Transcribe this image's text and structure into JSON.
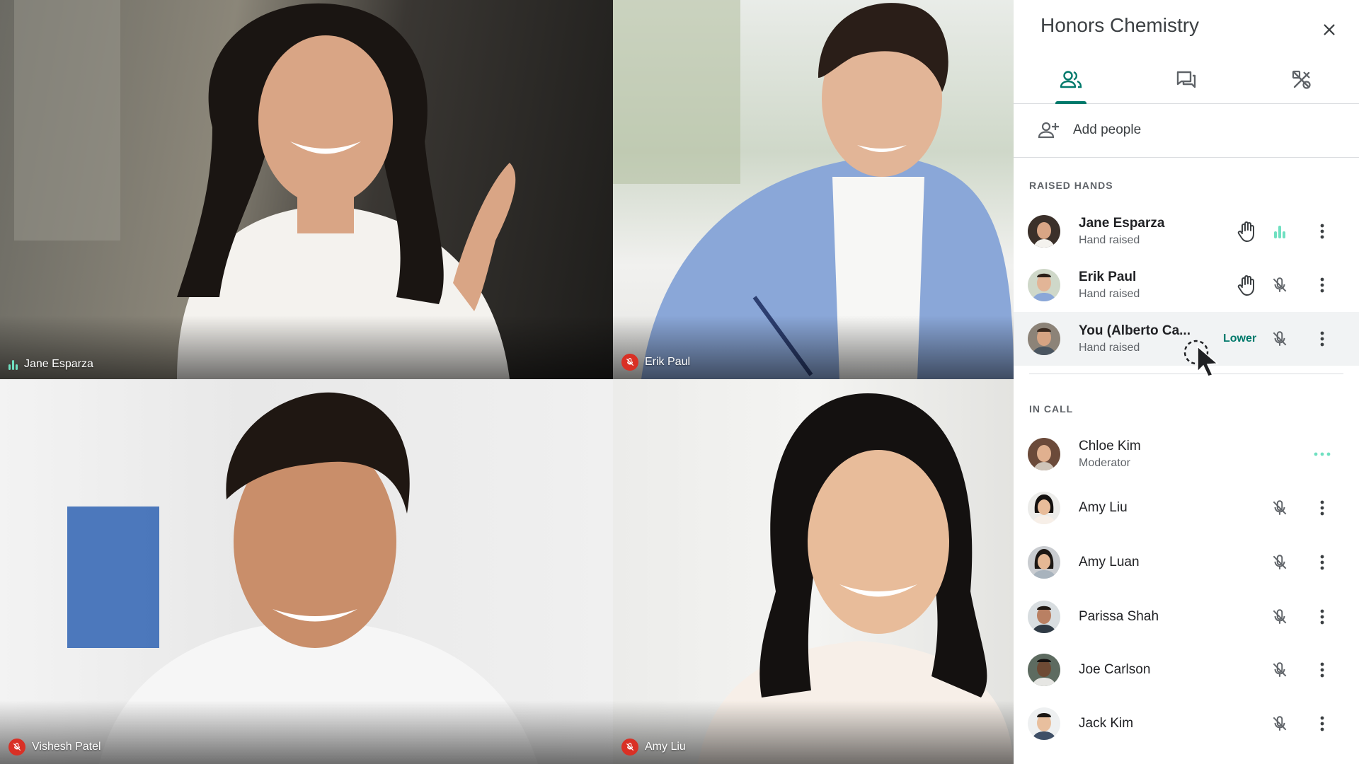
{
  "tiles": [
    {
      "name": "Jane Esparza",
      "status": "speaking"
    },
    {
      "name": "Erik Paul",
      "status": "muted"
    },
    {
      "name": "Vishesh Patel",
      "status": "muted"
    },
    {
      "name": "Amy Liu",
      "status": "muted"
    }
  ],
  "panel": {
    "title": "Honors Chemistry",
    "add_people": "Add people",
    "tabs": [
      "people-icon",
      "chat-icon",
      "activities-icon"
    ],
    "raised_hands_title": "RAISED HANDS",
    "raised_hands": [
      {
        "name": "Jane Esparza",
        "sub": "Hand raised",
        "mic": "speaking"
      },
      {
        "name": "Erik Paul",
        "sub": "Hand raised",
        "mic": "muted"
      },
      {
        "name": "You (Alberto Ca...",
        "sub": "Hand raised",
        "action": "Lower",
        "mic": "muted"
      }
    ],
    "in_call_title": "IN CALL",
    "in_call": [
      {
        "name": "Chloe Kim",
        "sub": "Moderator"
      },
      {
        "name": "Amy Liu"
      },
      {
        "name": "Amy Luan"
      },
      {
        "name": "Parissa Shah"
      },
      {
        "name": "Joe Carlson"
      },
      {
        "name": "Jack Kim"
      }
    ]
  },
  "colors": {
    "accent": "#00796b",
    "speaking": "#6fe0c1",
    "muted_badge": "#d93025"
  }
}
